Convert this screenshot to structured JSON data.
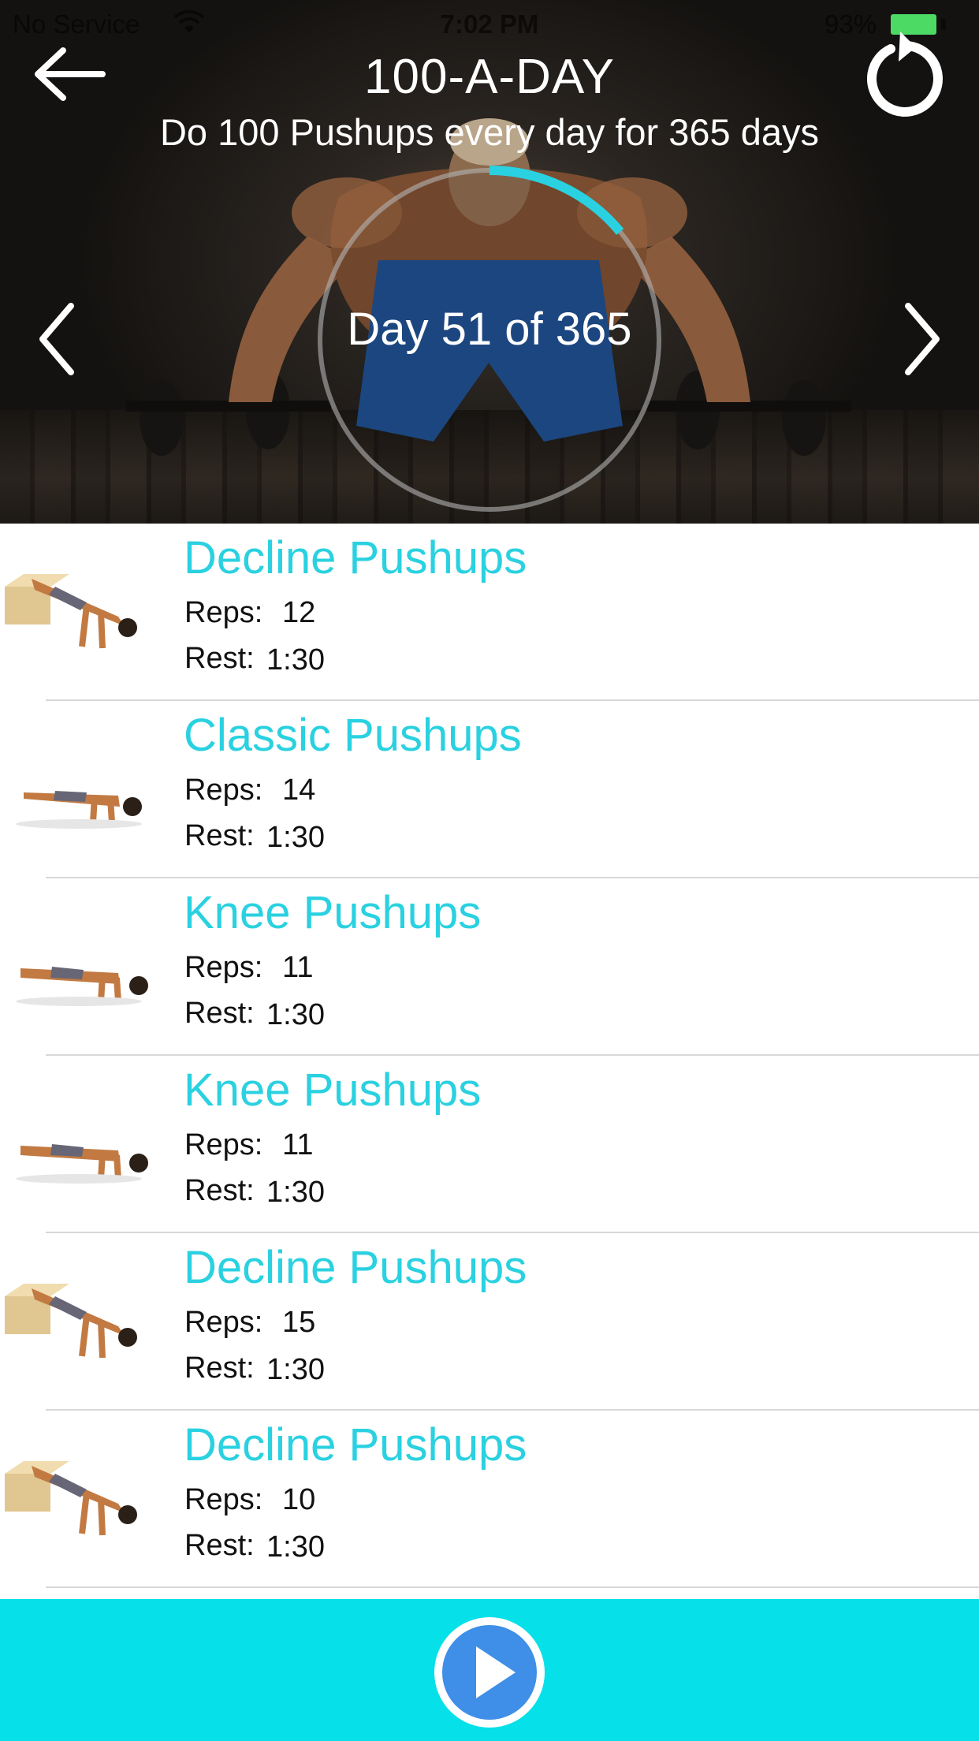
{
  "status_bar": {
    "carrier": "No Service",
    "time": "7:02 PM",
    "battery": "93%",
    "battery_color": "#4cd964"
  },
  "header": {
    "title": "100-A-DAY",
    "subtitle": "Do 100 Pushups every day for 365 days",
    "day_label": "Day 51 of 365",
    "progress_fraction": 0.14,
    "accent_color": "#2ad1e0",
    "icons": {
      "back": "arrow-left-icon",
      "reset": "restart-icon",
      "prev": "chevron-left-icon",
      "next": "chevron-right-icon"
    }
  },
  "exercises": [
    {
      "name": "Decline Pushups",
      "reps_label": "Reps:",
      "reps": "12",
      "rest_label": "Rest:",
      "rest": "1:30",
      "variant": "decline"
    },
    {
      "name": "Classic Pushups",
      "reps_label": "Reps:",
      "reps": "14",
      "rest_label": "Rest:",
      "rest": "1:30",
      "variant": "classic"
    },
    {
      "name": "Knee Pushups",
      "reps_label": "Reps:",
      "reps": "11",
      "rest_label": "Rest:",
      "rest": "1:30",
      "variant": "knee"
    },
    {
      "name": "Knee Pushups",
      "reps_label": "Reps:",
      "reps": "11",
      "rest_label": "Rest:",
      "rest": "1:30",
      "variant": "knee"
    },
    {
      "name": "Decline Pushups",
      "reps_label": "Reps:",
      "reps": "15",
      "rest_label": "Rest:",
      "rest": "1:30",
      "variant": "decline"
    },
    {
      "name": "Decline Pushups",
      "reps_label": "Reps:",
      "reps": "10",
      "rest_label": "Rest:",
      "rest": "1:30",
      "variant": "decline"
    }
  ],
  "bottom_bar": {
    "background": "#06e0e9",
    "play_icon": "play-icon"
  }
}
